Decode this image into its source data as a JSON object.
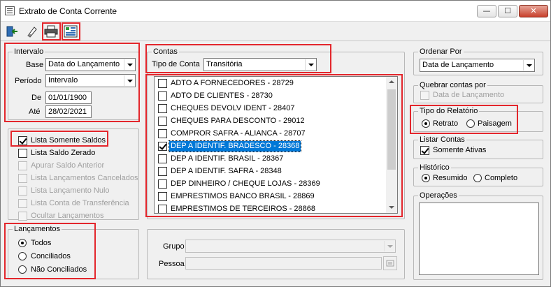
{
  "window": {
    "title": "Extrato de Conta Corrente",
    "minimize_glyph": "—",
    "maximize_glyph": "☐",
    "close_glyph": "✕"
  },
  "toolbar": {
    "exit_icon": "exit-door-icon",
    "eraser_icon": "eraser-icon",
    "print_icon": "printer-icon",
    "preview_icon": "report-preview-icon"
  },
  "intervalo": {
    "label": "Intervalo",
    "base_label": "Base",
    "base_value": "Data do Lançamento",
    "periodo_label": "Período",
    "periodo_value": "Intervalo",
    "de_label": "De",
    "de_value": "01/01/1900",
    "ate_label": "Até",
    "ate_value": "28/02/2021"
  },
  "options": {
    "items": [
      {
        "label": "Lista Somente Saldos",
        "checked": true,
        "enabled": true
      },
      {
        "label": "Lista Saldo Zerado",
        "checked": false,
        "enabled": true
      },
      {
        "label": "Apurar Saldo Anterior",
        "checked": false,
        "enabled": false
      },
      {
        "label": "Lista Lançamentos Cancelados",
        "checked": false,
        "enabled": false
      },
      {
        "label": "Lista Lançamento Nulo",
        "checked": false,
        "enabled": false
      },
      {
        "label": "Lista Conta de Transferência",
        "checked": false,
        "enabled": false
      },
      {
        "label": "Ocultar Lançamentos",
        "checked": false,
        "enabled": false
      }
    ]
  },
  "lancamentos": {
    "label": "Lançamentos",
    "options": [
      {
        "label": "Todos",
        "checked": true
      },
      {
        "label": "Conciliados",
        "checked": false
      },
      {
        "label": "Não Conciliados",
        "checked": false
      }
    ]
  },
  "contas": {
    "label": "Contas",
    "tipo_label": "Tipo de Conta",
    "tipo_value": "Transitória",
    "items": [
      {
        "label": "ADTO A FORNECEDORES - 28729",
        "checked": false,
        "selected": false
      },
      {
        "label": "ADTO DE CLIENTES - 28730",
        "checked": false,
        "selected": false
      },
      {
        "label": "CHEQUES DEVOLV IDENT - 28407",
        "checked": false,
        "selected": false
      },
      {
        "label": "CHEQUES PARA DESCONTO - 29012",
        "checked": false,
        "selected": false
      },
      {
        "label": "COMPROR SAFRA - ALIANCA - 28707",
        "checked": false,
        "selected": false
      },
      {
        "label": "DEP A IDENTIF. BRADESCO - 28368",
        "checked": true,
        "selected": true
      },
      {
        "label": "DEP A IDENTIF. BRASIL - 28367",
        "checked": false,
        "selected": false
      },
      {
        "label": "DEP A IDENTIF. SAFRA - 28348",
        "checked": false,
        "selected": false
      },
      {
        "label": "DEP DINHEIRO / CHEQUE LOJAS - 28369",
        "checked": false,
        "selected": false
      },
      {
        "label": "EMPRESTIMOS BANCO BRASIL - 28869",
        "checked": false,
        "selected": false
      },
      {
        "label": "EMPRESTIMOS DE TERCEIROS - 28868",
        "checked": false,
        "selected": false
      }
    ]
  },
  "filtros": {
    "grupo_label": "Grupo",
    "grupo_value": "",
    "pessoa_label": "Pessoa",
    "pessoa_value": ""
  },
  "ordenar": {
    "label": "Ordenar Por",
    "value": "Data de Lançamento"
  },
  "quebrar": {
    "label": "Quebrar contas por",
    "option_label": "Data de Lançamento",
    "checked": false
  },
  "tipo_relatorio": {
    "label": "Tipo do Relatório",
    "options": [
      {
        "label": "Retrato",
        "checked": true
      },
      {
        "label": "Paisagem",
        "checked": false
      }
    ]
  },
  "listar_contas": {
    "label": "Listar Contas",
    "option_label": "Somente Ativas",
    "checked": true
  },
  "historico": {
    "label": "Histórico",
    "options": [
      {
        "label": "Resumido",
        "checked": true
      },
      {
        "label": "Completo",
        "checked": false
      }
    ]
  },
  "operacoes": {
    "label": "Operações"
  },
  "colors": {
    "highlight": "#e3262c",
    "selection": "#0078d7",
    "face": "#f0f0f0"
  }
}
